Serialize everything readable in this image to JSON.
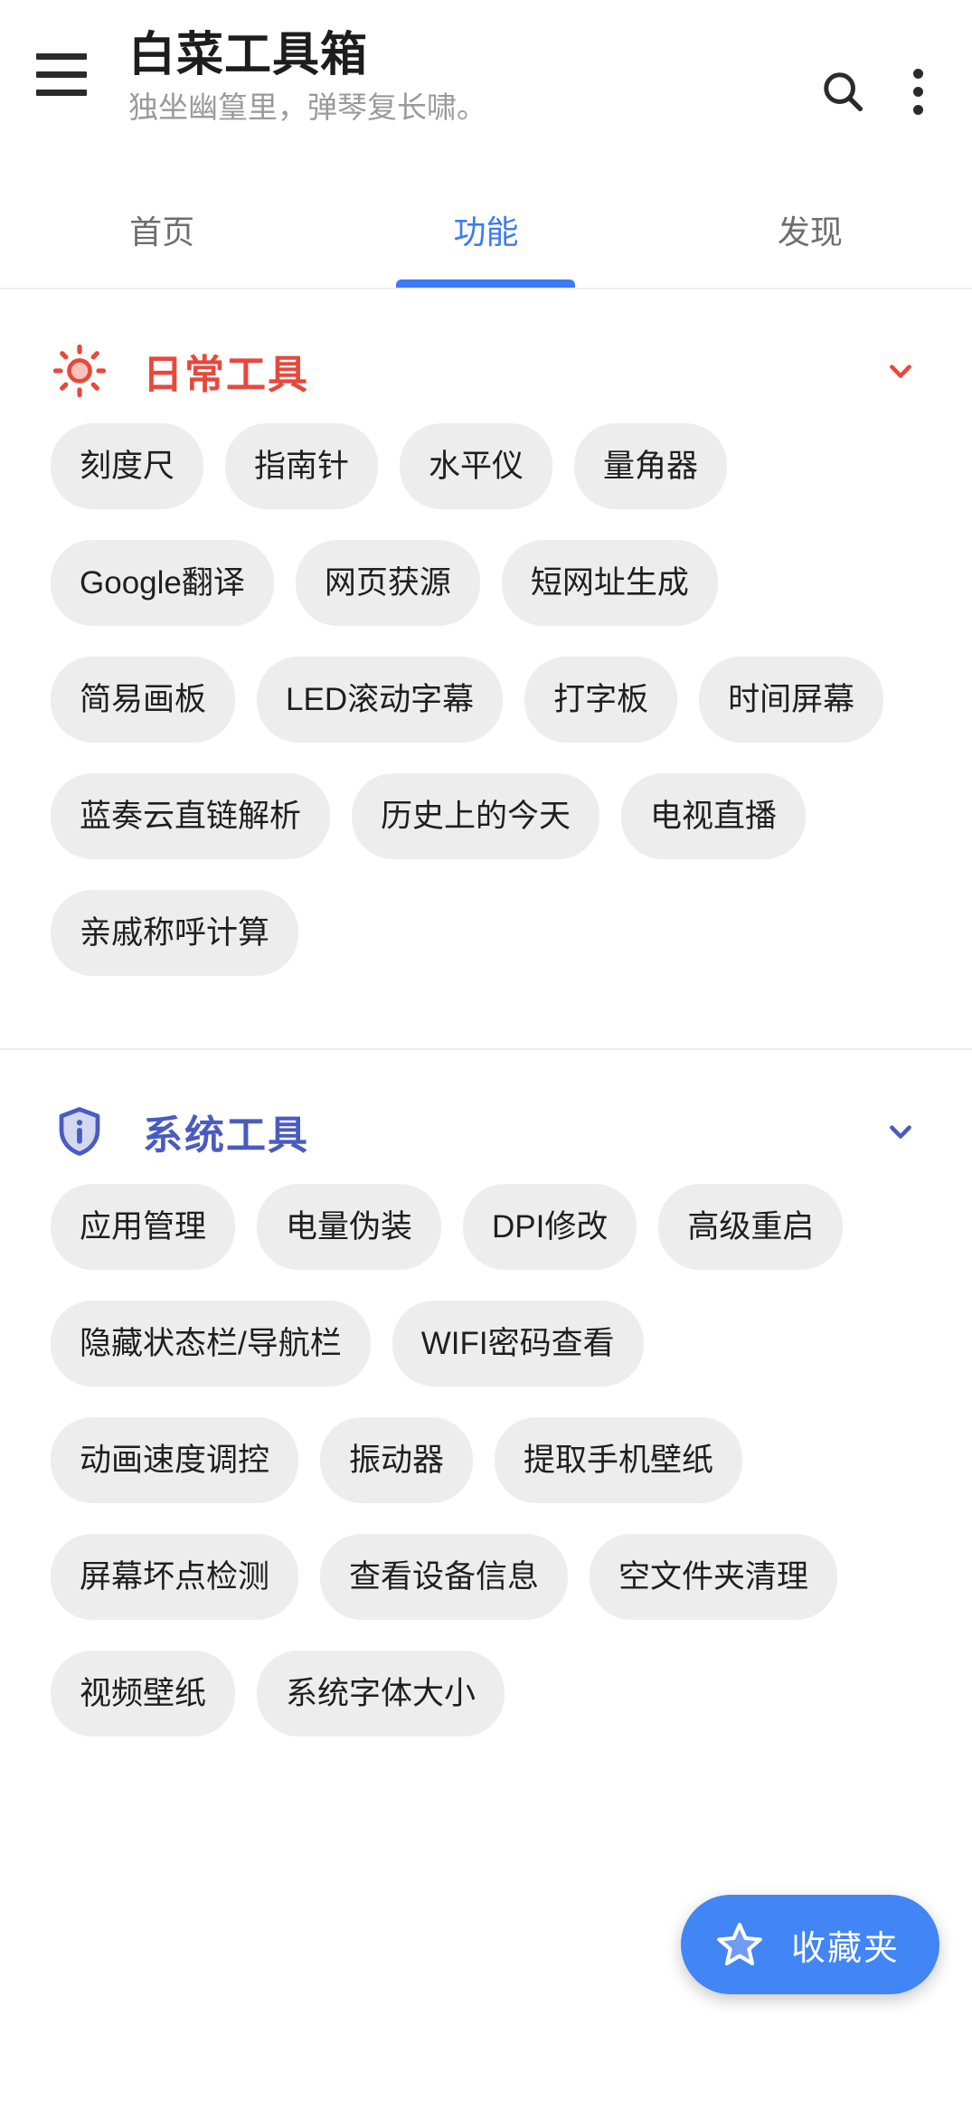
{
  "appbar": {
    "menu_icon": "hamburger-menu-icon",
    "title": "白菜工具箱",
    "subtitle": "独坐幽篁里，弹琴复长啸。",
    "search_icon": "search-icon",
    "overflow_icon": "more-vertical-icon"
  },
  "tabs": {
    "items": [
      {
        "label": "首页",
        "active": false
      },
      {
        "label": "功能",
        "active": true
      },
      {
        "label": "发现",
        "active": false
      }
    ],
    "active_color": "#3c7bf5"
  },
  "sections": [
    {
      "title": "日常工具",
      "color": "#e8483c",
      "icon": "sun-icon",
      "chevron_icon": "chevron-down-icon",
      "expanded": true,
      "chips": [
        "刻度尺",
        "指南针",
        "水平仪",
        "量角器",
        "Google翻译",
        "网页获源",
        "短网址生成",
        "简易画板",
        "LED滚动字幕",
        "打字板",
        "时间屏幕",
        "蓝奏云直链解析",
        "历史上的今天",
        "电视直播",
        "亲戚称呼计算"
      ]
    },
    {
      "title": "系统工具",
      "color": "#4a5bc0",
      "icon": "shield-info-icon",
      "chevron_icon": "chevron-down-icon",
      "expanded": true,
      "chips": [
        "应用管理",
        "电量伪装",
        "DPI修改",
        "高级重启",
        "隐藏状态栏/导航栏",
        "WIFI密码查看",
        "动画速度调控",
        "振动器",
        "提取手机壁纸",
        "屏幕坏点检测",
        "查看设备信息",
        "空文件夹清理",
        "视频壁纸",
        "系统字体大小"
      ]
    }
  ],
  "fab": {
    "label": "收藏夹",
    "icon": "star-outline-icon",
    "color": "#4285f4"
  },
  "chip_style": {
    "background": "#ededed",
    "text_color": "#1f1f1f"
  }
}
